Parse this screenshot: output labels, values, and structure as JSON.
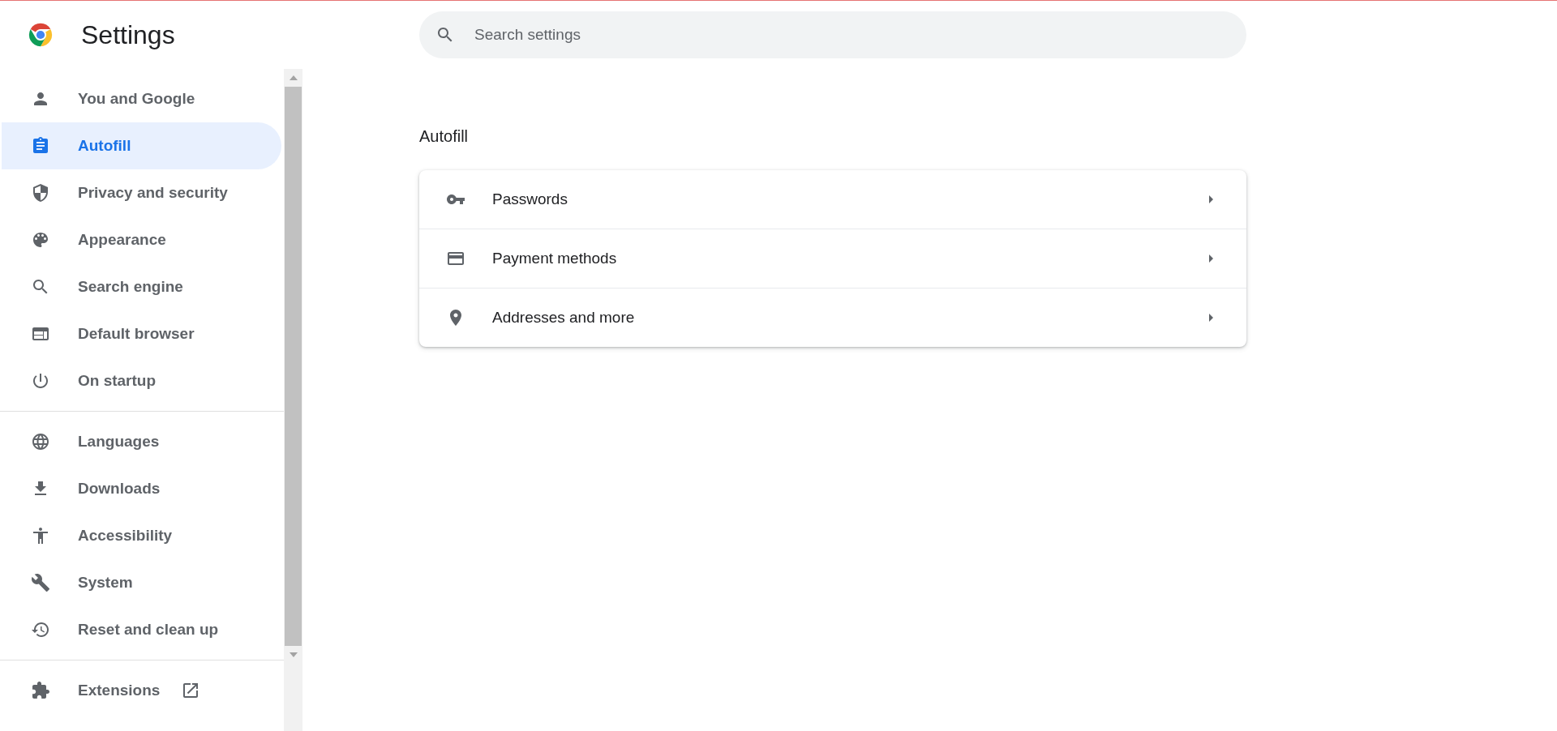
{
  "header": {
    "title": "Settings"
  },
  "search": {
    "placeholder": "Search settings"
  },
  "sidebar": {
    "groups": [
      {
        "items": [
          {
            "label": "You and Google",
            "kind": "person",
            "selected": false
          },
          {
            "label": "Autofill",
            "kind": "clipboard",
            "selected": true
          },
          {
            "label": "Privacy and security",
            "kind": "shield",
            "selected": false
          },
          {
            "label": "Appearance",
            "kind": "palette",
            "selected": false
          },
          {
            "label": "Search engine",
            "kind": "search",
            "selected": false
          },
          {
            "label": "Default browser",
            "kind": "browser",
            "selected": false
          },
          {
            "label": "On startup",
            "kind": "power",
            "selected": false
          }
        ]
      },
      {
        "items": [
          {
            "label": "Languages",
            "kind": "globe",
            "selected": false
          },
          {
            "label": "Downloads",
            "kind": "download",
            "selected": false
          },
          {
            "label": "Accessibility",
            "kind": "accessibility",
            "selected": false
          },
          {
            "label": "System",
            "kind": "wrench",
            "selected": false
          },
          {
            "label": "Reset and clean up",
            "kind": "history",
            "selected": false
          }
        ]
      },
      {
        "items": [
          {
            "label": "Extensions",
            "kind": "puzzle",
            "selected": false,
            "external": true
          }
        ]
      }
    ]
  },
  "section": {
    "title": "Autofill",
    "rows": [
      {
        "label": "Passwords",
        "kind": "key"
      },
      {
        "label": "Payment methods",
        "kind": "card"
      },
      {
        "label": "Addresses and more",
        "kind": "pin"
      }
    ]
  }
}
